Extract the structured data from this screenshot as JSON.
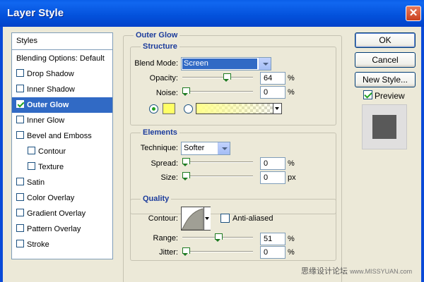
{
  "window": {
    "title": "Layer Style",
    "close_glyph": "✕"
  },
  "styles_list": {
    "header": "Styles",
    "items": [
      {
        "label": "Blending Options: Default",
        "checkbox": false,
        "checked": false,
        "indent": false,
        "selected": false
      },
      {
        "label": "Drop Shadow",
        "checkbox": true,
        "checked": false,
        "indent": false,
        "selected": false
      },
      {
        "label": "Inner Shadow",
        "checkbox": true,
        "checked": false,
        "indent": false,
        "selected": false
      },
      {
        "label": "Outer Glow",
        "checkbox": true,
        "checked": true,
        "indent": false,
        "selected": true
      },
      {
        "label": "Inner Glow",
        "checkbox": true,
        "checked": false,
        "indent": false,
        "selected": false
      },
      {
        "label": "Bevel and Emboss",
        "checkbox": true,
        "checked": false,
        "indent": false,
        "selected": false
      },
      {
        "label": "Contour",
        "checkbox": true,
        "checked": false,
        "indent": true,
        "selected": false
      },
      {
        "label": "Texture",
        "checkbox": true,
        "checked": false,
        "indent": true,
        "selected": false
      },
      {
        "label": "Satin",
        "checkbox": true,
        "checked": false,
        "indent": false,
        "selected": false
      },
      {
        "label": "Color Overlay",
        "checkbox": true,
        "checked": false,
        "indent": false,
        "selected": false
      },
      {
        "label": "Gradient Overlay",
        "checkbox": true,
        "checked": false,
        "indent": false,
        "selected": false
      },
      {
        "label": "Pattern Overlay",
        "checkbox": true,
        "checked": false,
        "indent": false,
        "selected": false
      },
      {
        "label": "Stroke",
        "checkbox": true,
        "checked": false,
        "indent": false,
        "selected": false
      }
    ]
  },
  "outer_glow": {
    "title": "Outer Glow",
    "structure": {
      "title": "Structure",
      "blend_mode_label": "Blend Mode:",
      "blend_mode_value": "Screen",
      "opacity_label": "Opacity:",
      "opacity_value": "64",
      "opacity_fraction": 0.64,
      "opacity_unit": "%",
      "noise_label": "Noise:",
      "noise_value": "0",
      "noise_fraction": 0,
      "noise_unit": "%",
      "color_mode": "solid",
      "glow_color": "#ffff66"
    },
    "elements": {
      "title": "Elements",
      "technique_label": "Technique:",
      "technique_value": "Softer",
      "spread_label": "Spread:",
      "spread_value": "0",
      "spread_fraction": 0,
      "spread_unit": "%",
      "size_label": "Size:",
      "size_value": "0",
      "size_fraction": 0,
      "size_unit": "px"
    },
    "quality": {
      "title": "Quality",
      "contour_label": "Contour:",
      "anti_aliased_label": "Anti-aliased",
      "anti_aliased_checked": false,
      "range_label": "Range:",
      "range_value": "51",
      "range_fraction": 0.51,
      "range_unit": "%",
      "jitter_label": "Jitter:",
      "jitter_value": "0",
      "jitter_fraction": 0,
      "jitter_unit": "%"
    }
  },
  "buttons": {
    "ok": "OK",
    "cancel": "Cancel",
    "new_style": "New Style..."
  },
  "preview": {
    "label": "Preview",
    "checked": true
  },
  "watermark": {
    "text": "思缘设计论坛",
    "site": "www.MISSYUAN.com"
  },
  "colors": {
    "title_bar": "#0a5ee8",
    "selection": "#316ac5",
    "section_title": "#1c3c9c",
    "glow_color": "#ffff66"
  }
}
